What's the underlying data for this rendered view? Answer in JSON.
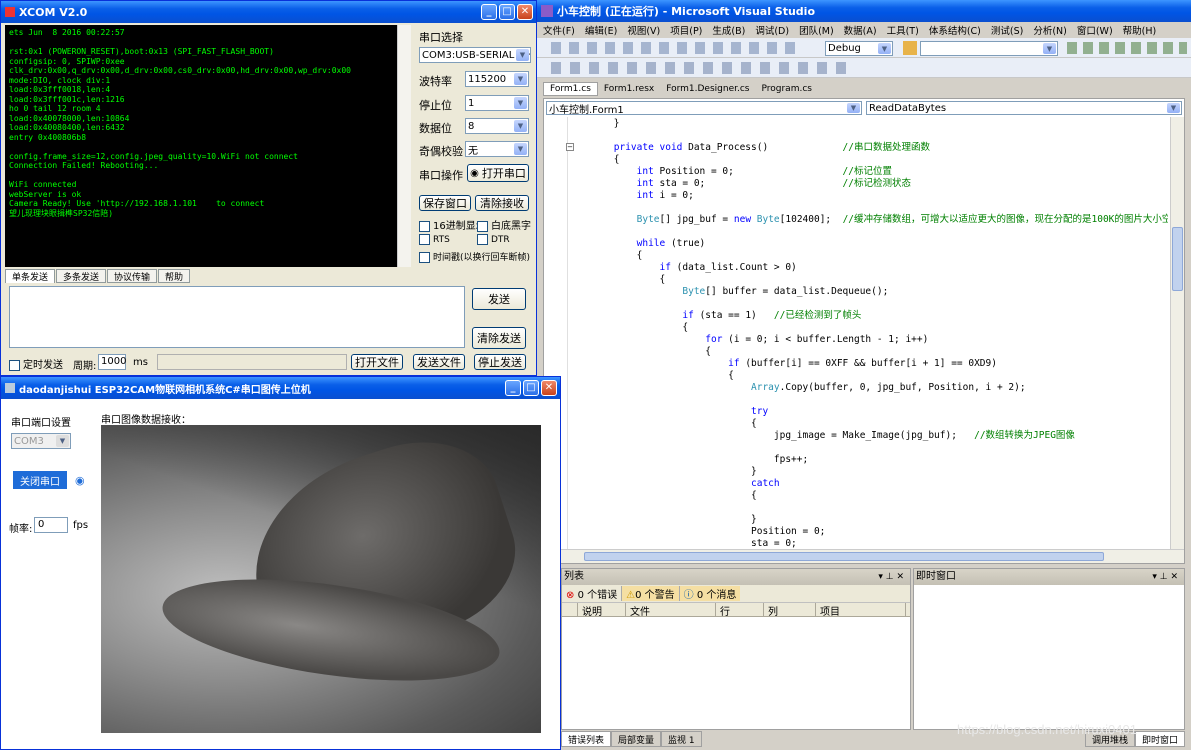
{
  "xcom": {
    "title": "XCOM V2.0",
    "terminal": [
      "ets Jun  8 2016 00:22:57",
      "",
      "rst:0x1 (POWERON_RESET),boot:0x13 (SPI_FAST_FLASH_BOOT)",
      "configsip: 0, SPIWP:0xee",
      "clk_drv:0x00,q_drv:0x00,d_drv:0x00,cs0_drv:0x00,hd_drv:0x00,wp_drv:0x00",
      "mode:DIO, clock div:1",
      "load:0x3fff0018,len:4",
      "load:0x3fff001c,len:1216",
      "ho 0 tail 12 room 4",
      "load:0x40078000,len:10864",
      "load:0x40080400,len:6432",
      "entry 0x400806b8",
      "",
      "config.frame_size=12,config.jpeg_quality=10.WiFi not connect",
      "Connection Failed! Rebooting...",
      "",
      "WiFi connected",
      "webServer is ok",
      "Camera Ready! Use 'http://192.168.1.101    to connect",
      "望儿现理块眼揖榫SP32信陪)"
    ],
    "labels": {
      "port_select": "串口选择",
      "port": "COM3:USB-SERIAL CH340",
      "baud_label": "波特率",
      "baud": "115200",
      "stop_label": "停止位",
      "stop": "1",
      "data_label": "数据位",
      "data": "8",
      "parity_label": "奇偶校验",
      "parity": "无",
      "op_label": "串口操作",
      "open_btn": "打开串口",
      "save_btn": "保存窗口",
      "clear_recv": "清除接收",
      "hex_display": "16进制显示",
      "white_bg": "白底黑字",
      "rts": "RTS",
      "dtr": "DTR",
      "timestamp": "时间戳(以换行回车断帧)"
    },
    "tabs": [
      "单条发送",
      "多条发送",
      "协议传输",
      "帮助"
    ],
    "send_btn": "发送",
    "clear_send": "清除发送",
    "timed_send": "定时发送",
    "period_label": "周期:",
    "period": "1000",
    "ms": "ms",
    "open_file": "打开文件",
    "send_file": "发送文件",
    "stop_send": "停止发送"
  },
  "vs": {
    "title": "小车控制 (正在运行) - Microsoft Visual Studio",
    "menu": [
      "文件(F)",
      "编辑(E)",
      "视图(V)",
      "项目(P)",
      "生成(B)",
      "调试(D)",
      "团队(M)",
      "数据(A)",
      "工具(T)",
      "体系结构(C)",
      "测试(S)",
      "分析(N)",
      "窗口(W)",
      "帮助(H)"
    ],
    "config": "Debug",
    "tabs": [
      "Form1.cs",
      "Form1.resx",
      "Form1.Designer.cs",
      "Program.cs"
    ],
    "class_combo": "小车控制.Form1",
    "method_combo": "ReadDataBytes",
    "code": [
      [
        [
          "",
          "        }"
        ]
      ],
      [
        [
          "",
          ""
        ]
      ],
      [
        [
          "kw",
          "        private void "
        ],
        [
          "",
          "Data_Process()             "
        ],
        [
          "cm",
          "//串口数据处理函数"
        ]
      ],
      [
        [
          "",
          "        {"
        ]
      ],
      [
        [
          "kw",
          "            int "
        ],
        [
          "",
          "Position = 0;                   "
        ],
        [
          "cm",
          "//标记位置"
        ]
      ],
      [
        [
          "kw",
          "            int "
        ],
        [
          "",
          "sta = 0;                        "
        ],
        [
          "cm",
          "//标记检测状态"
        ]
      ],
      [
        [
          "kw",
          "            int "
        ],
        [
          "",
          "i = 0;"
        ]
      ],
      [
        [
          "",
          ""
        ]
      ],
      [
        [
          "ty",
          "            Byte"
        ],
        [
          "",
          "[] jpg_buf = "
        ],
        [
          "kw",
          "new "
        ],
        [
          "ty",
          "Byte"
        ],
        [
          "",
          "[102400];  "
        ],
        [
          "cm",
          "//缓冲存储数组，可增大以适应更大的图像，现在分配的是100K的图片大小空间"
        ]
      ],
      [
        [
          "",
          ""
        ]
      ],
      [
        [
          "kw",
          "            while "
        ],
        [
          "",
          "(true)"
        ]
      ],
      [
        [
          "",
          "            {"
        ]
      ],
      [
        [
          "kw",
          "                if "
        ],
        [
          "",
          "(data_list.Count > 0)"
        ]
      ],
      [
        [
          "",
          "                {"
        ]
      ],
      [
        [
          "ty",
          "                    Byte"
        ],
        [
          "",
          "[] buffer = data_list.Dequeue();"
        ]
      ],
      [
        [
          "",
          ""
        ]
      ],
      [
        [
          "kw",
          "                    if "
        ],
        [
          "",
          "(sta == 1)   "
        ],
        [
          "cm",
          "//已经检测到了帧头"
        ]
      ],
      [
        [
          "",
          "                    {"
        ]
      ],
      [
        [
          "kw",
          "                        for "
        ],
        [
          "",
          "(i = 0; i < buffer.Length - 1; i++)"
        ]
      ],
      [
        [
          "",
          "                        {"
        ]
      ],
      [
        [
          "kw",
          "                            if "
        ],
        [
          "",
          "(buffer[i] == 0XFF && buffer[i + 1] == 0XD9)"
        ]
      ],
      [
        [
          "",
          "                            {"
        ]
      ],
      [
        [
          "ty",
          "                                Array"
        ],
        [
          "",
          ".Copy(buffer, 0, jpg_buf, Position, i + 2);"
        ]
      ],
      [
        [
          "",
          ""
        ]
      ],
      [
        [
          "kw",
          "                                try"
        ]
      ],
      [
        [
          "",
          "                                {"
        ]
      ],
      [
        [
          "",
          "                                    jpg_image = Make_Image(jpg_buf);   "
        ],
        [
          "cm",
          "//数组转换为JPEG图像"
        ]
      ],
      [
        [
          "",
          ""
        ]
      ],
      [
        [
          "",
          "                                    fps++;"
        ]
      ],
      [
        [
          "",
          "                                }"
        ]
      ],
      [
        [
          "kw",
          "                                catch"
        ]
      ],
      [
        [
          "",
          "                                {"
        ]
      ],
      [
        [
          "",
          ""
        ]
      ],
      [
        [
          "",
          "                                }"
        ]
      ],
      [
        [
          "",
          "                                Position = 0;"
        ]
      ],
      [
        [
          "",
          "                                sta = 0;"
        ]
      ]
    ],
    "zoom": "%",
    "errlist": {
      "title": "列表",
      "errors": "0 个错误",
      "warnings": "0 个警告",
      "messages": "0 个消息",
      "cols": [
        "说明",
        "文件",
        "行",
        "列",
        "项目"
      ]
    },
    "immediate": "即时窗口",
    "bottom_tabs": [
      "错误列表",
      "局部变量",
      "监视 1"
    ],
    "bottom_tabs2": [
      "调用堆栈",
      "即时窗口"
    ],
    "watermark": "https://blog.csdn.net/hiruxi0401"
  },
  "esp": {
    "title": "daodanjishui ESP32CAM物联网相机系统C#串口图传上位机",
    "port_group": "串口端口设置",
    "port": "COM3",
    "close_btn": "关闭串口",
    "fps_label": "帧率:",
    "fps": "0",
    "fps_unit": "fps",
    "image_label": "串口图像数据接收："
  }
}
